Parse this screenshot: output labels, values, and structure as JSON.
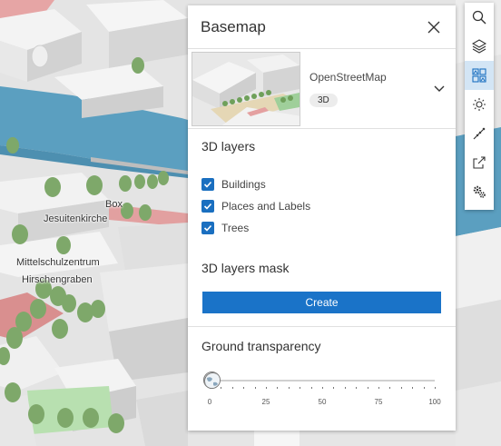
{
  "map": {
    "labels": {
      "box": "Box",
      "jesuitenkirche": "Jesuitenkirche",
      "mittelschulzentrum": "Mittelschulzentrum",
      "hirschengraben": "Hirschengraben"
    }
  },
  "panel": {
    "title": "Basemap",
    "basemap": {
      "name": "OpenStreetMap",
      "badge": "3D"
    },
    "layers_section": {
      "title": "3D layers",
      "items": [
        {
          "label": "Buildings",
          "checked": true
        },
        {
          "label": "Places and Labels",
          "checked": true
        },
        {
          "label": "Trees",
          "checked": true
        }
      ]
    },
    "mask_section": {
      "title": "3D layers mask",
      "button_label": "Create"
    },
    "ground_section": {
      "title": "Ground transparency",
      "slider": {
        "value": 0,
        "min": 0,
        "max": 100,
        "tick_labels": [
          "0",
          "25",
          "50",
          "75",
          "100"
        ]
      }
    }
  },
  "toolbar": {
    "tools": [
      {
        "icon": "search-icon",
        "active": false
      },
      {
        "icon": "layers-icon",
        "active": false
      },
      {
        "icon": "basemap-gallery-icon",
        "active": true
      },
      {
        "icon": "daylight-icon",
        "active": false
      },
      {
        "icon": "measure-icon",
        "active": false
      },
      {
        "icon": "share-icon",
        "active": false
      },
      {
        "icon": "settings-icon",
        "active": false
      }
    ]
  },
  "colors": {
    "accent": "#1a73c8",
    "checkbox": "#1a6fc0",
    "active_tool": "#d3e5f5",
    "water": "#5b9fc0"
  }
}
